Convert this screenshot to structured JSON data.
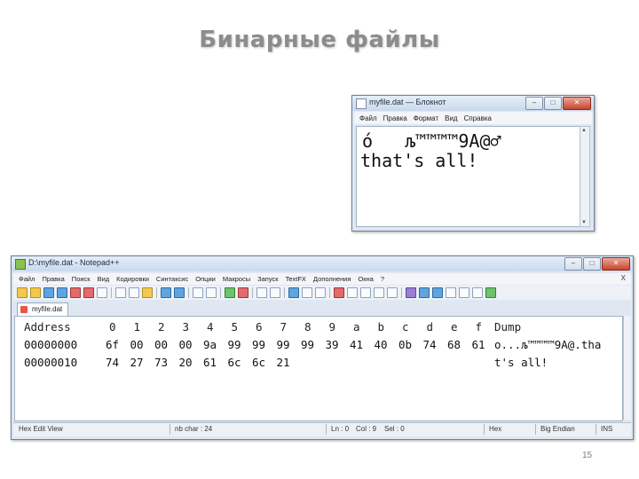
{
  "slide": {
    "title": "Бинарные файлы",
    "page_number": "15"
  },
  "notepad": {
    "title": "myfile.dat — Блокнот",
    "menu": [
      "Файл",
      "Правка",
      "Формат",
      "Вид",
      "Справка"
    ],
    "content_line1": "ó   љ™™™™9A@♂",
    "content_line2": "that's all!"
  },
  "npp": {
    "title": "D:\\myfile.dat - Notepad++",
    "menu": [
      "Файл",
      "Правка",
      "Поиск",
      "Вид",
      "Кодировки",
      "Синтаксис",
      "Опции",
      "Макросы",
      "Запуск",
      "TextFX",
      "Дополнения",
      "Окна",
      "?"
    ],
    "close_doc": "X",
    "tab_label": "myfile.dat",
    "hex": {
      "header": {
        "address": "Address",
        "columns": [
          "0",
          "1",
          "2",
          "3",
          "4",
          "5",
          "6",
          "7",
          "8",
          "9",
          "a",
          "b",
          "c",
          "d",
          "e",
          "f"
        ],
        "dump": "Dump"
      },
      "rows": [
        {
          "address": "00000000",
          "bytes": [
            "6f",
            "00",
            "00",
            "00",
            "9a",
            "99",
            "99",
            "99",
            "99",
            "39",
            "41",
            "40",
            "0b",
            "74",
            "68",
            "61"
          ],
          "dump": "o...љ™™™™9A@.tha"
        },
        {
          "address": "00000010",
          "bytes": [
            "74",
            "27",
            "73",
            "20",
            "61",
            "6c",
            "6c",
            "21"
          ],
          "dump": "t's all!"
        }
      ]
    },
    "status": {
      "mode": "Hex Edit View",
      "nb_char": "nb char : 24",
      "ln": "Ln : 0",
      "col": "Col : 9",
      "sel": "Sel : 0",
      "format": "Hex",
      "endian": "Big Endian",
      "ins": "INS"
    }
  }
}
